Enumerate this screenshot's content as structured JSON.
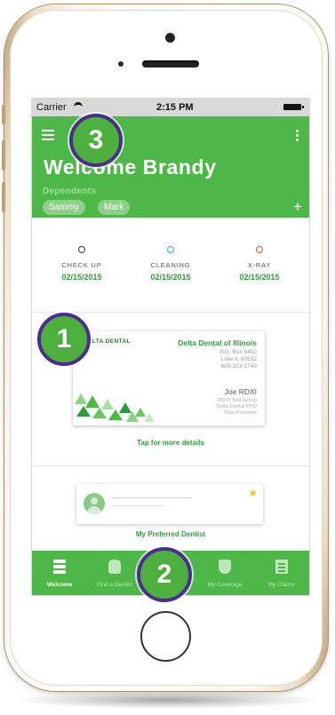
{
  "statusbar": {
    "carrier": "Carrier",
    "time": "2:15 PM"
  },
  "header": {
    "title": "Welcome Brandy",
    "dependents_label": "Dependents",
    "dependents": [
      "Sammy",
      "Mark"
    ],
    "add_symbol": "+"
  },
  "appointments": [
    {
      "title": "CHECK UP",
      "date": "02/15/2015",
      "color": "#2a2f7a"
    },
    {
      "title": "CLEANING",
      "date": "02/15/2015",
      "color": "#2aa8c9"
    },
    {
      "title": "X-RAY",
      "date": "02/15/2015",
      "color": "#e0542a"
    }
  ],
  "insurance_card": {
    "brand": "DELTA DENTAL",
    "insurer": "Delta Dental of Illinois",
    "address_lines": [
      "P.O. Box 5402",
      "Lisle IL 60532",
      "800-323-1743"
    ],
    "member_name": "Joe RDXI",
    "plan_lines": [
      "RDXI Test Group",
      "Delta Dental PPO",
      "Plus Premiere"
    ],
    "link_text": "Tap for more details"
  },
  "preferred_dentist": {
    "link_text": "My Preferred Dentist"
  },
  "tabbar": {
    "tabs": [
      {
        "label": "Welcome",
        "icon": "home-lines-icon",
        "active": true
      },
      {
        "label": "Find a Dentist",
        "icon": "tooth-search-icon",
        "active": false
      },
      {
        "label": "",
        "icon": "calendar-icon",
        "active": false
      },
      {
        "label": "My Coverage",
        "icon": "shield-tooth-icon",
        "active": false
      },
      {
        "label": "My Claims",
        "icon": "document-icon",
        "active": false
      }
    ]
  },
  "callouts": {
    "one": "1",
    "two": "2",
    "three": "3"
  },
  "colors": {
    "brand_green": "#4db848",
    "callout_border": "#4a2d8c",
    "link_green": "#2e9c3c"
  }
}
